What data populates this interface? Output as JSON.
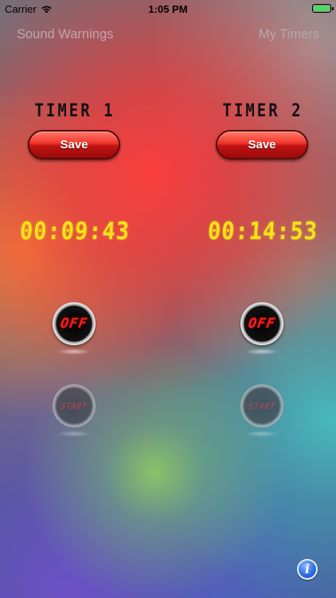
{
  "status_bar": {
    "carrier": "Carrier",
    "time": "1:05 PM",
    "battery_color": "#4cd964"
  },
  "nav": {
    "left_label": "Sound Warnings",
    "right_label": "My Timers"
  },
  "timers": [
    {
      "title": "TIMER 1",
      "save_label": "Save",
      "display": "00:09:43",
      "off_label": "OFF",
      "start_label": "START"
    },
    {
      "title": "TIMER 2",
      "save_label": "Save",
      "display": "00:14:53",
      "off_label": "OFF",
      "start_label": "START"
    }
  ],
  "info_button": {
    "glyph": "i",
    "icon": "info-icon"
  },
  "colors": {
    "accent_red": "#f23a2e",
    "digit_yellow": "#f5e21a",
    "off_red": "#ff1e1e"
  }
}
